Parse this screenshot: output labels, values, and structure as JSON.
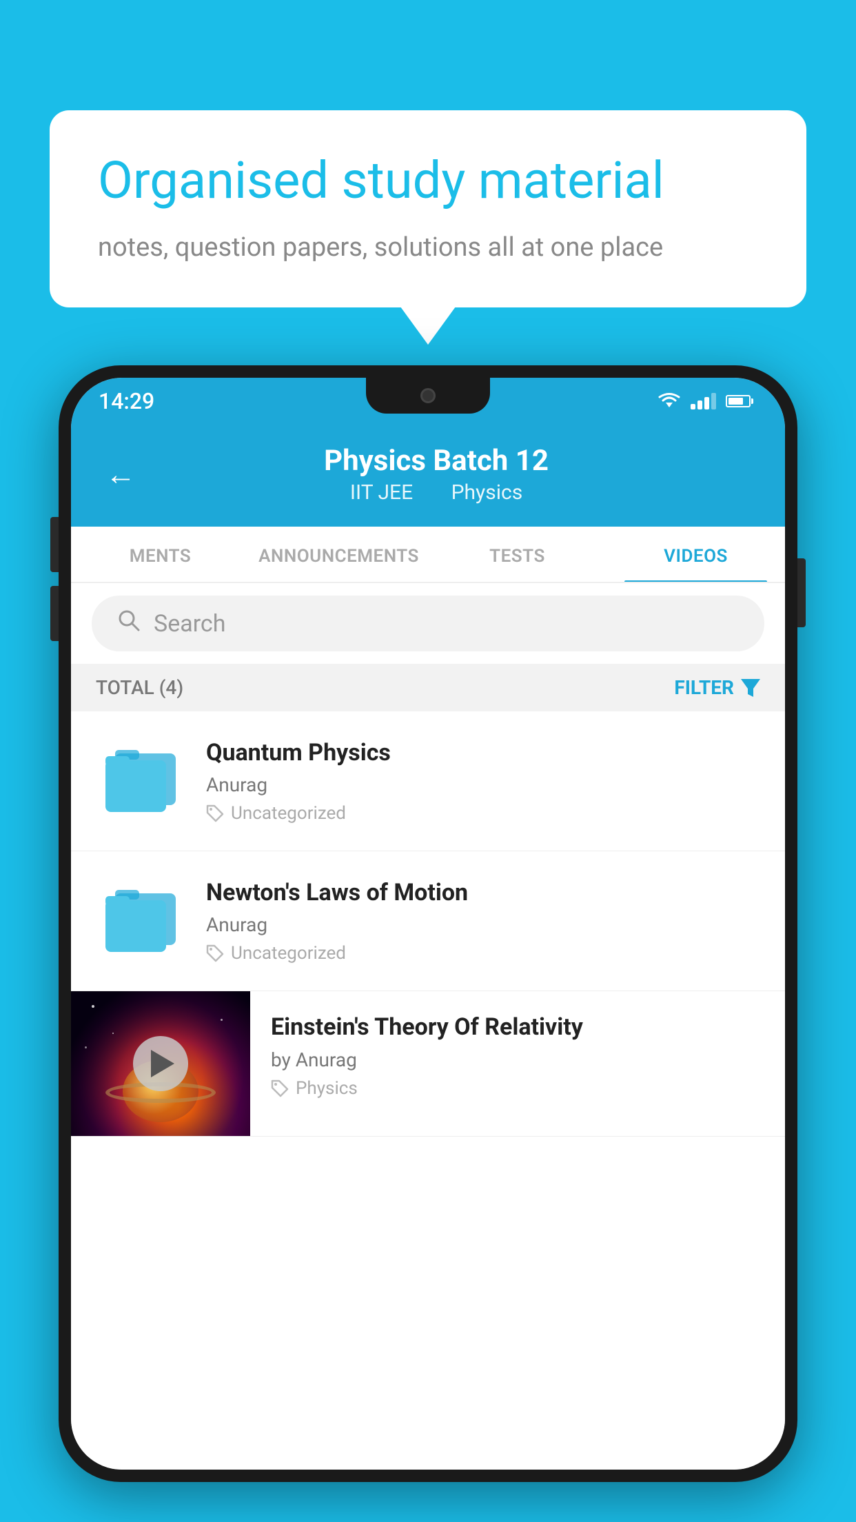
{
  "background_color": "#1bbde8",
  "speech_bubble": {
    "title": "Organised study material",
    "subtitle": "notes, question papers, solutions all at one place"
  },
  "phone": {
    "status_bar": {
      "time": "14:29"
    },
    "header": {
      "title": "Physics Batch 12",
      "subtitle_left": "IIT JEE",
      "subtitle_right": "Physics",
      "back_label": "←"
    },
    "tabs": [
      {
        "label": "MENTS",
        "active": false
      },
      {
        "label": "ANNOUNCEMENTS",
        "active": false
      },
      {
        "label": "TESTS",
        "active": false
      },
      {
        "label": "VIDEOS",
        "active": true
      }
    ],
    "search": {
      "placeholder": "Search"
    },
    "filter": {
      "total_label": "TOTAL (4)",
      "filter_label": "FILTER"
    },
    "videos": [
      {
        "title": "Quantum Physics",
        "author": "Anurag",
        "tag": "Uncategorized",
        "type": "folder"
      },
      {
        "title": "Newton's Laws of Motion",
        "author": "Anurag",
        "tag": "Uncategorized",
        "type": "folder"
      },
      {
        "title": "Einstein's Theory Of Relativity",
        "author": "by Anurag",
        "tag": "Physics",
        "type": "video"
      }
    ]
  }
}
